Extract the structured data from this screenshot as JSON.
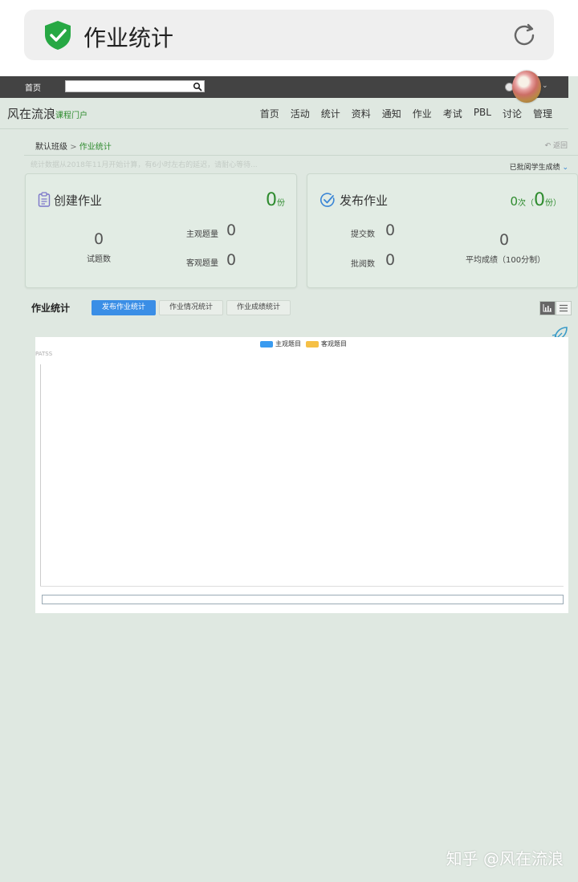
{
  "window": {
    "title": "作业统计"
  },
  "navbar": {
    "home": "首页",
    "search_placeholder": ""
  },
  "header": {
    "logo": "风在流浪",
    "logo_sub": "课程门户",
    "menu": [
      "首页",
      "活动",
      "统计",
      "资料",
      "通知",
      "作业",
      "考试",
      "PBL",
      "讨论",
      "管理"
    ]
  },
  "breadcrumb": {
    "class": "默认班级",
    "separator": ">",
    "current": "作业统计",
    "back": "返回"
  },
  "notice": "统计数据从2018年11月开始计算，有6小时左右的延迟，请耐心等待...",
  "grading_filter": "已批阅学生成绩",
  "create_card": {
    "title": "创建作业",
    "count": "0",
    "count_unit": "份",
    "questions_value": "0",
    "questions_label": "试题数",
    "subjective_label": "主观题量",
    "subjective_value": "0",
    "objective_label": "客观题量",
    "objective_value": "0"
  },
  "publish_card": {
    "title": "发布作业",
    "times": "0",
    "times_unit": "次",
    "paren_open": "（",
    "copies": "0",
    "copies_unit": "份）",
    "submit_label": "提交数",
    "submit_value": "0",
    "review_label": "批阅数",
    "review_value": "0",
    "avg_value": "0",
    "avg_label": "平均成绩（100分制）"
  },
  "stats": {
    "title": "作业统计",
    "tabs": [
      "发布作业统计",
      "作业情况统计",
      "作业成绩统计"
    ],
    "active_tab": 0
  },
  "chart_data": {
    "type": "bar",
    "title": "",
    "ylabel": "PATSS",
    "categories": [],
    "series": [
      {
        "name": "主观题目",
        "values": [],
        "color": "#3a9bf0"
      },
      {
        "name": "客观题目",
        "values": [],
        "color": "#f5c046"
      }
    ]
  },
  "watermark": "知乎 @风在流浪",
  "colors": {
    "accent_green": "#2e8b2e",
    "accent_blue": "#3a8ee6",
    "background": "#dfe8e1"
  }
}
